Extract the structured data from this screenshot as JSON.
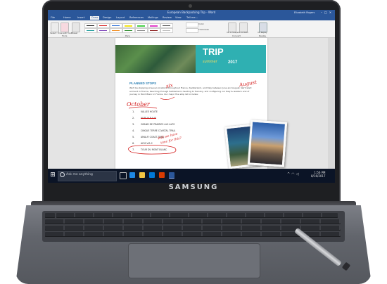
{
  "screen": {
    "window_title": "European Backpacking Trip - Word",
    "user_name": "Elizabeth Rogers",
    "tabs": [
      "File",
      "Home",
      "Insert",
      "Draw",
      "Design",
      "Layout",
      "References",
      "Mailings",
      "Review",
      "View",
      "Tell me..."
    ],
    "active_tab": "Draw",
    "ribbon_groups": {
      "tools_label": "Tools",
      "pens_label": "Pens",
      "convert_label": "Convert",
      "replay_label": "Replay",
      "select_label": "Select",
      "eraser_label": "Eraser",
      "draw_with_touch_label": "Draw with Touch",
      "ink_to_shape_label": "Ink to Shape",
      "ink_to_math_label": "Ink to Math",
      "ink_replay_label": "Ink Replay",
      "color_label": "Color",
      "thickness_label": "Thickness"
    },
    "document": {
      "banner_title": "TRIP",
      "banner_subtitle": "summer",
      "banner_year": "2017",
      "section_heading": "PLANNED STOPS",
      "intro_text": "We'll be stopping at seven locations throughout France, Switzerland, and Italy between June and August. We'll start and end in France, beaching through Switzerland, heading to Tuscany, and configuring our Italy & western end of journey in Mont Blanc in France. Our major five stop list includes:",
      "list_items": [
        {
          "num": "1.",
          "text": "VALLEE HOUTE"
        },
        {
          "num": "2.",
          "text": "ALPS ALP LUX"
        },
        {
          "num": "3.",
          "text": "GRAND DE PRAIRIES ALS ALPS"
        },
        {
          "num": "4.",
          "text": "CINQUE TERRE COASTAL TRAIL"
        },
        {
          "num": "5.",
          "text": "AMALFI COAST TRAIL"
        },
        {
          "num": "6.",
          "text": "ALTA VIA 2"
        },
        {
          "num": "7.",
          "text": "TOUR DU MONT BLANC"
        }
      ],
      "ink_annotations": {
        "six": "six",
        "august": "August",
        "october": "October",
        "will_we_have": "Will we have",
        "time_for_this": "time for this?"
      }
    },
    "taskbar": {
      "search_placeholder": "Ask me anything",
      "time": "1:56 PM",
      "date": "8/16/2017"
    }
  },
  "device": {
    "brand": "SAMSUNG"
  }
}
